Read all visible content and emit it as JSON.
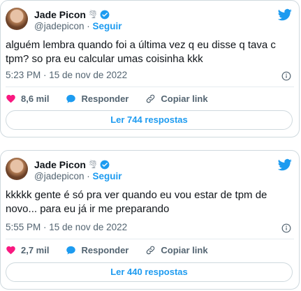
{
  "tweets": [
    {
      "name": "Jade Picon",
      "handle": "@jadepicon",
      "separator": "·",
      "follow": "Seguir",
      "text": "alguém lembra quando foi a última vez q eu disse q tava c tpm? so pra eu calcular umas coisinha kkk",
      "timestamp": "5:23 PM · 15 de nov de 2022",
      "likes": "8,6 mil",
      "reply_label": "Responder",
      "copy_label": "Copiar link",
      "read_replies": "Ler 744 respostas"
    },
    {
      "name": "Jade Picon",
      "handle": "@jadepicon",
      "separator": "·",
      "follow": "Seguir",
      "text": "kkkkk gente é só pra ver quando eu vou estar de tpm de novo... para eu já ir me preparando",
      "timestamp": "5:55 PM · 15 de nov de 2022",
      "likes": "2,7 mil",
      "reply_label": "Responder",
      "copy_label": "Copiar link",
      "read_replies": "Ler 440 respostas"
    }
  ],
  "colors": {
    "accent": "#1d9bf0",
    "like": "#f91880",
    "text": "#0f1419",
    "secondary": "#536471",
    "border": "#cfd9de"
  },
  "icons": [
    "tornado-icon",
    "verified-badge-icon",
    "twitter-bird-icon",
    "info-icon",
    "heart-icon",
    "reply-bubble-icon",
    "link-icon"
  ]
}
